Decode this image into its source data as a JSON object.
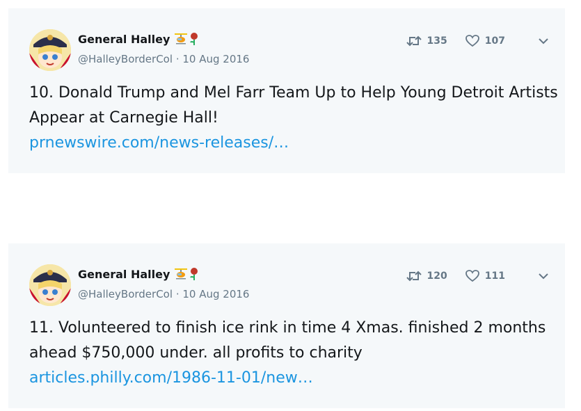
{
  "tweets": [
    {
      "name": "General Halley",
      "handle": "@HalleyBorderCol",
      "separator": "·",
      "date": "10 Aug 2016",
      "retweets": "135",
      "likes": "107",
      "text": "10. Donald Trump and Mel Farr Team Up to Help Young Detroit Artists Appear at Carnegie Hall!",
      "link": "prnewswire.com/news-releases/…",
      "icons": [
        "retweet-icon",
        "heart-icon",
        "chevron-down-icon"
      ]
    },
    {
      "name": "General Halley",
      "handle": "@HalleyBorderCol",
      "separator": "·",
      "date": "10 Aug 2016",
      "retweets": "120",
      "likes": "111",
      "text": "11. Volunteered to finish ice rink in time 4 Xmas. finished 2 months ahead $750,000 under. all profits to charity",
      "link": "articles.philly.com/1986-11-01/new…",
      "icons": [
        "retweet-icon",
        "heart-icon",
        "chevron-down-icon"
      ]
    }
  ],
  "colors": {
    "card_bg": "#f5f8fa",
    "text": "#14171a",
    "muted": "#657786",
    "link": "#1b95e0"
  }
}
